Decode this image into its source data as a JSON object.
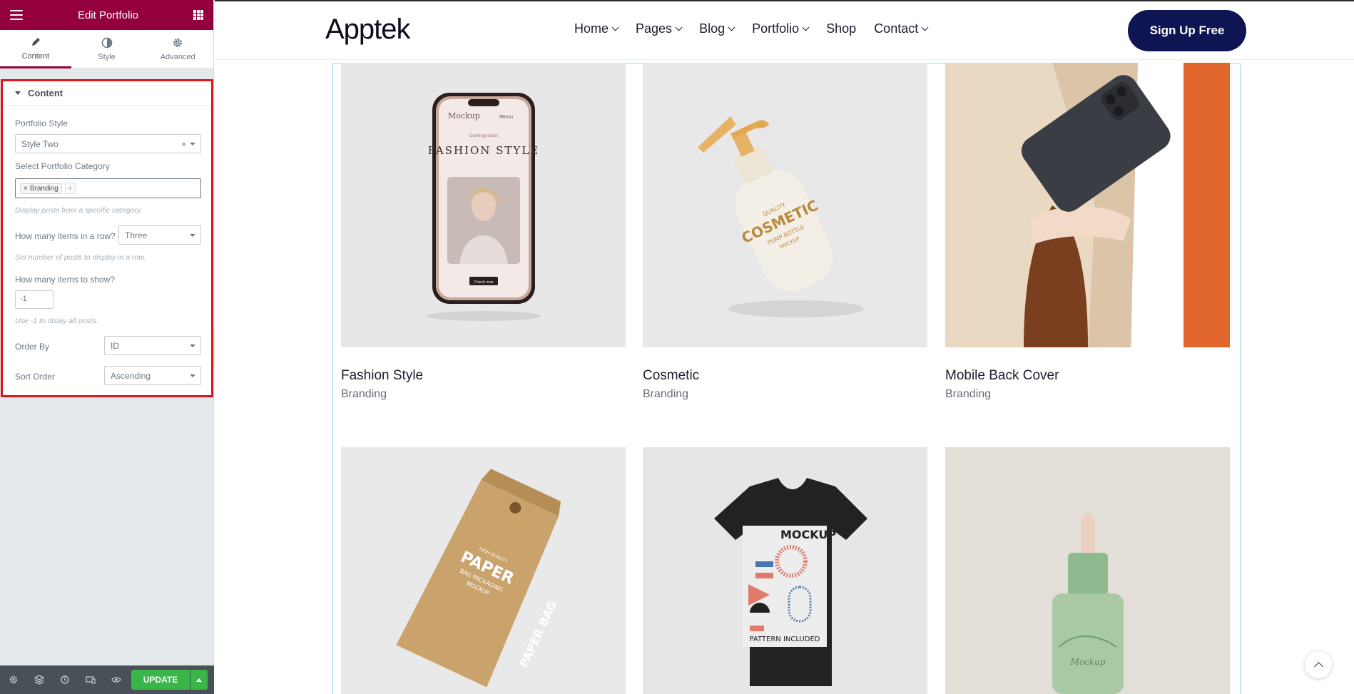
{
  "editor": {
    "header_title": "Edit Portfolio",
    "tabs": [
      {
        "label": "Content",
        "icon": "pencil-icon"
      },
      {
        "label": "Style",
        "icon": "contrast-icon"
      },
      {
        "label": "Advanced",
        "icon": "gear-icon"
      }
    ],
    "section_title": "Content",
    "portfolio_style": {
      "label": "Portfolio Style",
      "value": "Style Two"
    },
    "category": {
      "label": "Select Portfolio Category",
      "tag": "Branding",
      "help": "Display posts from a specific category."
    },
    "items_per_row": {
      "label": "How many items in a row?",
      "value": "Three",
      "help": "Set number of posts to display in a row."
    },
    "items_to_show": {
      "label": "How many items to show?",
      "value": "-1",
      "help": "Use -1 to dislay all posts."
    },
    "order_by": {
      "label": "Order By",
      "value": "ID"
    },
    "sort_order": {
      "label": "Sort Order",
      "value": "Ascending"
    },
    "footer": {
      "update_label": "UPDATE"
    }
  },
  "site": {
    "logo": "Apptek",
    "nav": [
      {
        "label": "Home",
        "dropdown": true
      },
      {
        "label": "Pages",
        "dropdown": true
      },
      {
        "label": "Blog",
        "dropdown": true
      },
      {
        "label": "Portfolio",
        "dropdown": true
      },
      {
        "label": "Shop",
        "dropdown": false
      },
      {
        "label": "Contact",
        "dropdown": true
      }
    ],
    "signup_label": "Sign Up Free",
    "portfolio": [
      {
        "title": "Fashion Style",
        "category": "Branding"
      },
      {
        "title": "Cosmetic",
        "category": "Branding"
      },
      {
        "title": "Mobile Back Cover",
        "category": "Branding"
      }
    ],
    "mockup_text": {
      "phone_brand": "Mockup",
      "phone_menu": "Menu",
      "phone_coming": "Coming Soon",
      "phone_headline": "FASHION STYLE",
      "phone_btn": "Check now",
      "bottle_top": "QUALITY",
      "bottle_main": "COSMETIC",
      "bottle_sub": "PUMP BOTTLE",
      "bottle_mock": "MOCKUP",
      "bag_top": "HIGH QUALITY",
      "bag_main": "PAPER",
      "bag_sub": "BAG PACKAGING",
      "bag_mock": "MOCKUP",
      "bag_side": "PAPER BAG",
      "tshirt_title": "MOCKUP",
      "tshirt_sub": "PATTERN INCLUDED",
      "dropper_label": "Mockup"
    }
  }
}
